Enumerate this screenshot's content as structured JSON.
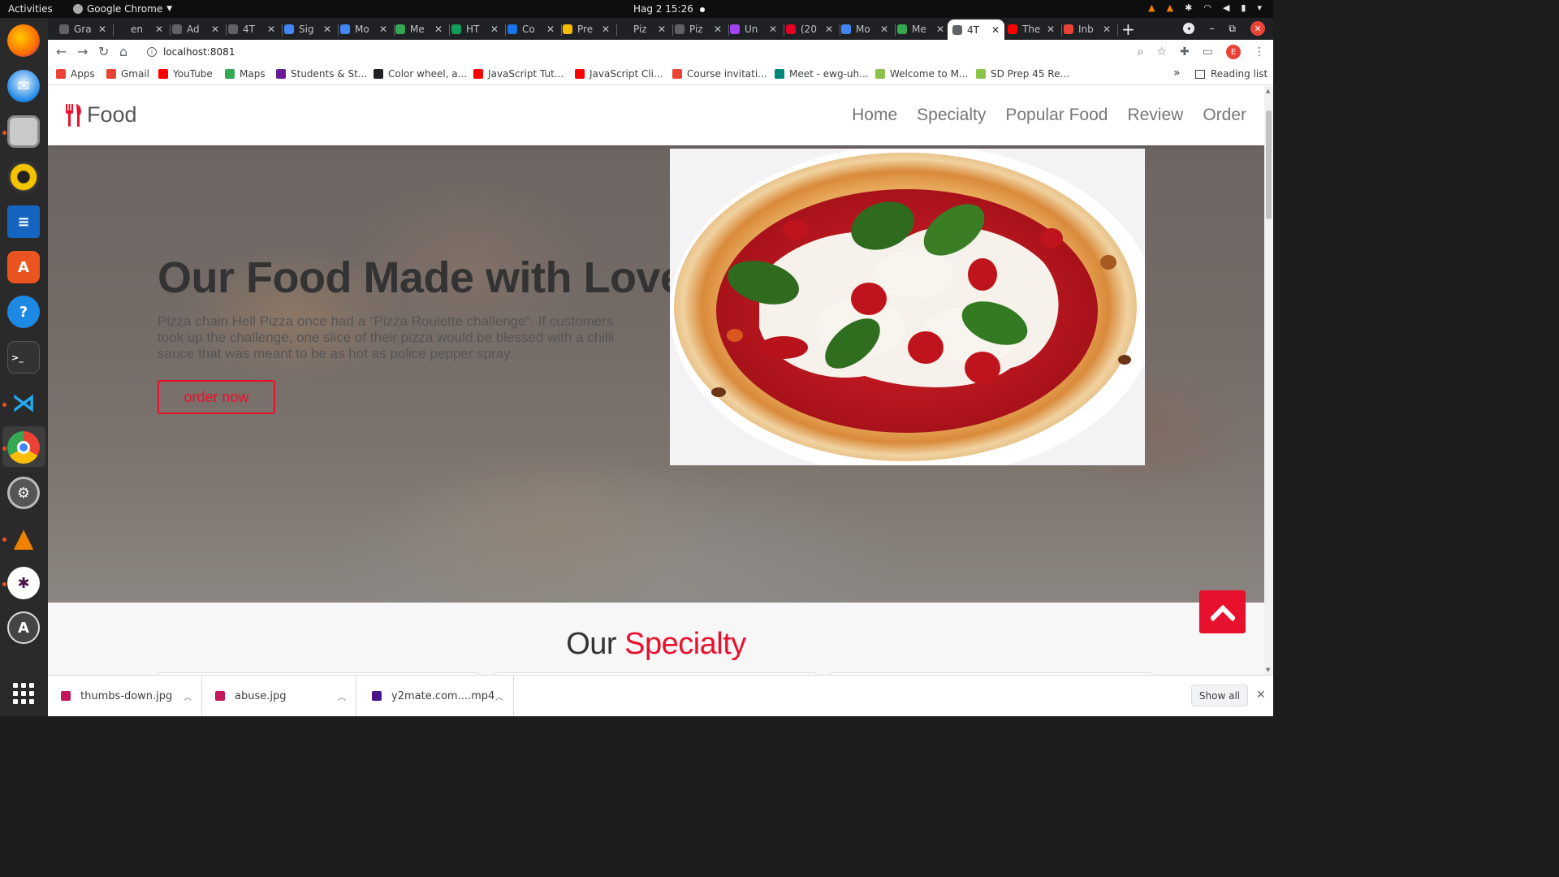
{
  "os": {
    "activities": "Activities",
    "app_name": "Google Chrome",
    "clock": "Hag 2  15:26"
  },
  "tabs": [
    {
      "label": "Gra",
      "color": "#5f6368"
    },
    {
      "label": "en",
      "color": "#202124"
    },
    {
      "label": "Ad",
      "color": "#5f6368"
    },
    {
      "label": "4T",
      "color": "#5f6368"
    },
    {
      "label": "Sig",
      "color": "#4285f4"
    },
    {
      "label": "Mo",
      "color": "#4285f4"
    },
    {
      "label": "Me",
      "color": "#34a853"
    },
    {
      "label": "HT",
      "color": "#0f9d58"
    },
    {
      "label": "Co",
      "color": "#1a73e8"
    },
    {
      "label": "Pre",
      "color": "#fbbc04"
    },
    {
      "label": "Piz",
      "color": "#202124"
    },
    {
      "label": "Piz",
      "color": "#5f6368"
    },
    {
      "label": "Un",
      "color": "#a142f4"
    },
    {
      "label": "(20",
      "color": "#e60023"
    },
    {
      "label": "Mo",
      "color": "#4285f4"
    },
    {
      "label": "Me",
      "color": "#34a853"
    },
    {
      "label": "4T",
      "color": "#5f6368",
      "active": true
    },
    {
      "label": "The",
      "color": "#ff0000"
    },
    {
      "label": "Inb",
      "color": "#ea4335"
    }
  ],
  "address": "localhost:8081",
  "bookmarks": [
    {
      "label": "Apps",
      "color": "#ea4335"
    },
    {
      "label": "Gmail",
      "color": "#ea4335"
    },
    {
      "label": "YouTube",
      "color": "#ff0000"
    },
    {
      "label": "Maps",
      "color": "#34a853"
    },
    {
      "label": "Students & St...",
      "color": "#6a1b9a"
    },
    {
      "label": "Color wheel, a...",
      "color": "#202124"
    },
    {
      "label": "JavaScript Tut...",
      "color": "#ff0000"
    },
    {
      "label": "JavaScript Cli...",
      "color": "#ff0000"
    },
    {
      "label": "Course invitati...",
      "color": "#ea4335"
    },
    {
      "label": "Meet - ewg-uh...",
      "color": "#00897b"
    },
    {
      "label": "Welcome to M...",
      "color": "#8bc34a"
    },
    {
      "label": "SD Prep 45 Re...",
      "color": "#8bc34a"
    }
  ],
  "reading_list": "Reading list",
  "site": {
    "logo_text": "Food",
    "nav": [
      "Home",
      "Specialty",
      "Popular Food",
      "Review",
      "Order"
    ],
    "hero_title": "Our Food Made with Love",
    "hero_desc": "Pizza chain Hell Pizza once had a “Pizza Roulette challenge”. If customers took up the challenge, one slice of their pizza would be blessed with a chilli sauce that was meant to be as hot as police pepper spray.",
    "order_button": "order now",
    "specialty_title_a": "Our",
    "specialty_title_b": "Specialty",
    "accent": "#e8112d"
  },
  "downloads": [
    {
      "name": "thumbs-down.jpg",
      "color": "#c2185b"
    },
    {
      "name": "abuse.jpg",
      "color": "#c2185b"
    },
    {
      "name": "y2mate.com....mp4",
      "color": "#4a148c"
    }
  ],
  "show_all": "Show all"
}
